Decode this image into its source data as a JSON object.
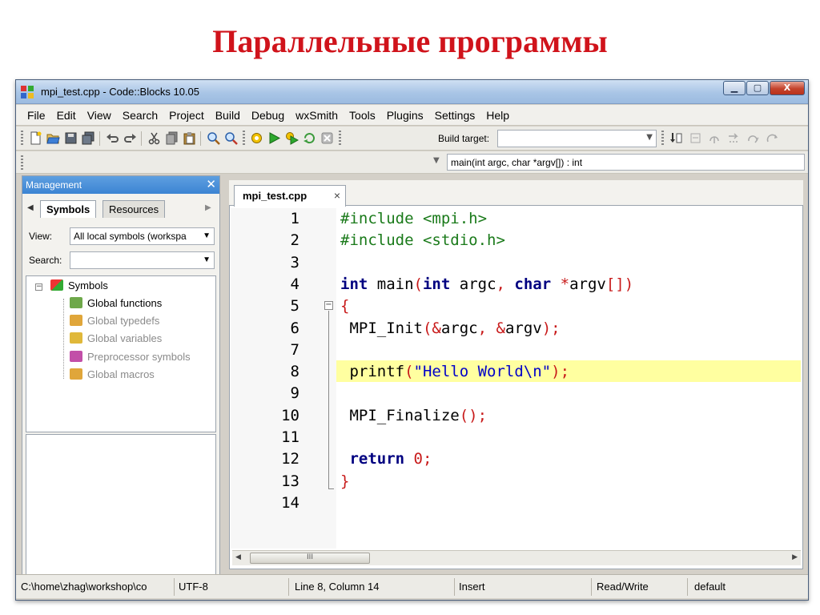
{
  "slide": {
    "title": "Параллельные программы"
  },
  "window": {
    "title": "mpi_test.cpp - Code::Blocks 10.05",
    "controls": {
      "minimize": "▁",
      "maximize": "▢",
      "close": "X"
    }
  },
  "menubar": {
    "items": [
      "File",
      "Edit",
      "View",
      "Search",
      "Project",
      "Build",
      "Debug",
      "wxSmith",
      "Tools",
      "Plugins",
      "Settings",
      "Help"
    ]
  },
  "toolbar": {
    "build_target_label": "Build target:",
    "build_target_value": "",
    "icons": [
      "new-file-icon",
      "open-icon",
      "save-icon",
      "save-all-icon",
      "undo-icon",
      "redo-icon",
      "cut-icon",
      "copy-icon",
      "paste-icon",
      "find-icon",
      "replace-icon",
      "build-icon",
      "run-icon",
      "build-run-icon",
      "rebuild-icon",
      "abort-icon",
      "debug-icon",
      "step-icons"
    ]
  },
  "function_bar": {
    "value": "main(int argc, char *argv[]) : int"
  },
  "management": {
    "title": "Management",
    "tabs": [
      "Symbols",
      "Resources"
    ],
    "active_tab": "Symbols",
    "view_label": "View:",
    "view_value": "All local symbols (workspa",
    "search_label": "Search:",
    "search_value": "",
    "tree": {
      "root": "Symbols",
      "children": [
        {
          "label": "Global functions",
          "dim": false,
          "color": "#6ea84a"
        },
        {
          "label": "Global typedefs",
          "dim": true,
          "color": "#e0a63a"
        },
        {
          "label": "Global variables",
          "dim": true,
          "color": "#e0b83a"
        },
        {
          "label": "Preprocessor symbols",
          "dim": true,
          "color": "#c24fa8"
        },
        {
          "label": "Global macros",
          "dim": true,
          "color": "#e0a63a"
        }
      ]
    }
  },
  "editor": {
    "tab_label": "mpi_test.cpp",
    "tab_close": "×",
    "highlighted_line": 8,
    "lines": [
      {
        "n": "1",
        "tokens": [
          [
            "pp",
            "#include <mpi.h>"
          ]
        ]
      },
      {
        "n": "2",
        "tokens": [
          [
            "pp",
            "#include <stdio.h>"
          ]
        ]
      },
      {
        "n": "3",
        "tokens": []
      },
      {
        "n": "4",
        "tokens": [
          [
            "kw",
            "int"
          ],
          [
            "",
            " main"
          ],
          [
            "pn",
            "("
          ],
          [
            "kw",
            "int"
          ],
          [
            "",
            " argc"
          ],
          [
            "pn",
            ","
          ],
          [
            "",
            " "
          ],
          [
            "kw",
            "char"
          ],
          [
            "",
            " "
          ],
          [
            "pn",
            "*"
          ],
          [
            "",
            "argv"
          ],
          [
            "pn",
            "[])"
          ]
        ]
      },
      {
        "n": "5",
        "tokens": [
          [
            "pn",
            "{"
          ]
        ]
      },
      {
        "n": "6",
        "tokens": [
          [
            "",
            " MPI_Init"
          ],
          [
            "pn",
            "(&"
          ],
          [
            "",
            "argc"
          ],
          [
            "pn",
            ","
          ],
          [
            "",
            " "
          ],
          [
            "pn",
            "&"
          ],
          [
            "",
            "argv"
          ],
          [
            "pn",
            ");"
          ]
        ]
      },
      {
        "n": "7",
        "tokens": []
      },
      {
        "n": "8",
        "tokens": [
          [
            "",
            " printf"
          ],
          [
            "pn",
            "("
          ],
          [
            "str",
            "\"Hello World\\n\""
          ],
          [
            "pn",
            ");"
          ]
        ]
      },
      {
        "n": "9",
        "tokens": []
      },
      {
        "n": "10",
        "tokens": [
          [
            "",
            " MPI_Finalize"
          ],
          [
            "pn",
            "();"
          ]
        ]
      },
      {
        "n": "11",
        "tokens": []
      },
      {
        "n": "12",
        "tokens": [
          [
            "",
            " "
          ],
          [
            "kw",
            "return"
          ],
          [
            "",
            " "
          ],
          [
            "num",
            "0"
          ],
          [
            "pn",
            ";"
          ]
        ]
      },
      {
        "n": "13",
        "tokens": [
          [
            "pn",
            "}"
          ]
        ]
      },
      {
        "n": "14",
        "tokens": []
      }
    ],
    "hscroll_thumb": "III"
  },
  "statusbar": {
    "path": "C:\\home\\zhag\\workshop\\co",
    "encoding": "UTF-8",
    "position": "Line 8, Column 14",
    "mode": "Insert",
    "access": "Read/Write",
    "lang": "default"
  }
}
